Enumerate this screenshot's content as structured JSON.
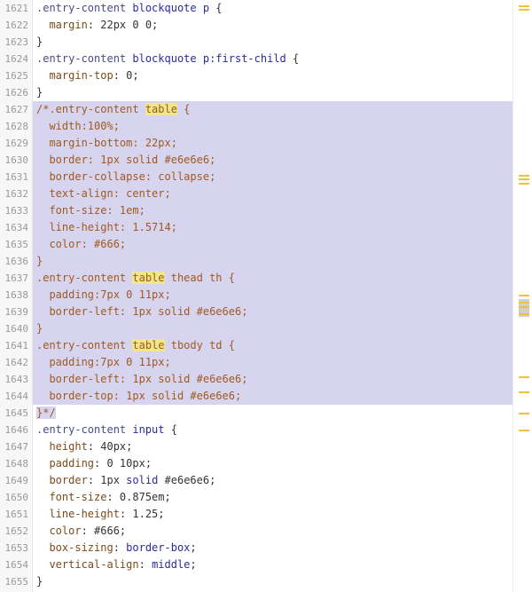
{
  "line_numbers": [
    "1621",
    "1622",
    "1623",
    "1624",
    "1625",
    "1626",
    "1627",
    "1628",
    "1629",
    "1630",
    "1631",
    "1632",
    "1633",
    "1634",
    "1635",
    "1636",
    "1637",
    "1638",
    "1639",
    "1640",
    "1641",
    "1642",
    "1643",
    "1644",
    "1645",
    "1646",
    "1647",
    "1648",
    "1649",
    "1650",
    "1651",
    "1652",
    "1653",
    "1654",
    "1655"
  ],
  "lines": [
    [
      [
        ".entry-content ",
        "t-sel"
      ],
      [
        "blockquote p",
        "t-kw"
      ],
      [
        " {",
        "t-st"
      ]
    ],
    [
      [
        "  ",
        "t-st"
      ],
      [
        "margin",
        "t-pr"
      ],
      [
        ": 22px 0 0;",
        "t-st"
      ]
    ],
    [
      [
        "}",
        "t-st"
      ]
    ],
    [
      [
        ".entry-content ",
        "t-sel"
      ],
      [
        "blockquote p:first-child",
        "t-kw"
      ],
      [
        " {",
        "t-st"
      ]
    ],
    [
      [
        "  ",
        "t-st"
      ],
      [
        "margin-top",
        "t-pr"
      ],
      [
        ": 0;",
        "t-st"
      ]
    ],
    [
      [
        "}",
        "t-st"
      ]
    ],
    [
      [
        "/*.entry-content ",
        "t-cm"
      ],
      [
        "table",
        "t-hl t-cm"
      ],
      [
        " {",
        "t-cm"
      ]
    ],
    [
      [
        "  width:100%;",
        "t-cm"
      ]
    ],
    [
      [
        "  margin-bottom: 22px;",
        "t-cm"
      ]
    ],
    [
      [
        "  border: 1px solid #e6e6e6;",
        "t-cm"
      ]
    ],
    [
      [
        "  border-collapse: collapse;",
        "t-cm"
      ]
    ],
    [
      [
        "  text-align: center;",
        "t-cm"
      ]
    ],
    [
      [
        "  font-size: 1em;",
        "t-cm"
      ]
    ],
    [
      [
        "  line-height: 1.5714;",
        "t-cm"
      ]
    ],
    [
      [
        "  color: #666;",
        "t-cm"
      ]
    ],
    [
      [
        "}",
        "t-cm"
      ]
    ],
    [
      [
        ".entry-content ",
        "t-cm"
      ],
      [
        "table",
        "t-hl t-cm"
      ],
      [
        " thead th {",
        "t-cm"
      ]
    ],
    [
      [
        "  padding:7px 0 11px;",
        "t-cm"
      ]
    ],
    [
      [
        "  border-left: 1px solid #e6e6e6;",
        "t-cm"
      ]
    ],
    [
      [
        "}",
        "t-cm"
      ]
    ],
    [
      [
        ".entry-content ",
        "t-cm"
      ],
      [
        "table",
        "t-hl t-cm"
      ],
      [
        " tbody td {",
        "t-cm"
      ]
    ],
    [
      [
        "  padding:7px 0 11px;",
        "t-cm"
      ]
    ],
    [
      [
        "  border-left: 1px solid #e6e6e6;",
        "t-cm"
      ]
    ],
    [
      [
        "  border-top: 1px solid #e6e6e6;",
        "t-cm"
      ]
    ],
    [
      [
        "}*/",
        "t-cm"
      ]
    ],
    [
      [
        ".entry-content ",
        "t-sel"
      ],
      [
        "input",
        "t-kw"
      ],
      [
        " {",
        "t-st"
      ]
    ],
    [
      [
        "  ",
        "t-st"
      ],
      [
        "height",
        "t-pr"
      ],
      [
        ": 40px;",
        "t-st"
      ]
    ],
    [
      [
        "  ",
        "t-st"
      ],
      [
        "padding",
        "t-pr"
      ],
      [
        ": 0 10px;",
        "t-st"
      ]
    ],
    [
      [
        "  ",
        "t-st"
      ],
      [
        "border",
        "t-pr"
      ],
      [
        ": 1px ",
        "t-st"
      ],
      [
        "solid",
        "t-kw"
      ],
      [
        " #e6e6e6;",
        "t-st"
      ]
    ],
    [
      [
        "  ",
        "t-st"
      ],
      [
        "font-size",
        "t-pr"
      ],
      [
        ": 0.875em;",
        "t-st"
      ]
    ],
    [
      [
        "  ",
        "t-st"
      ],
      [
        "line-height",
        "t-pr"
      ],
      [
        ": 1.25;",
        "t-st"
      ]
    ],
    [
      [
        "  ",
        "t-st"
      ],
      [
        "color",
        "t-pr"
      ],
      [
        ": #666;",
        "t-st"
      ]
    ],
    [
      [
        "  ",
        "t-st"
      ],
      [
        "box-sizing",
        "t-pr"
      ],
      [
        ": ",
        "t-st"
      ],
      [
        "border-box",
        "t-kw"
      ],
      [
        ";",
        "t-st"
      ]
    ],
    [
      [
        "  ",
        "t-st"
      ],
      [
        "vertical-align",
        "t-pr"
      ],
      [
        ": ",
        "t-st"
      ],
      [
        "middle",
        "t-kw"
      ],
      [
        ";",
        "t-st"
      ]
    ],
    [
      [
        "}",
        "t-st"
      ]
    ]
  ],
  "selected_line_indices": [
    6,
    7,
    8,
    9,
    10,
    11,
    12,
    13,
    14,
    15,
    16,
    17,
    18,
    19,
    20,
    21,
    22,
    23
  ],
  "selection_color": "#d7d4f0",
  "highlight_color": "#f0e68c",
  "scroll_marker_color": "#f0c040"
}
